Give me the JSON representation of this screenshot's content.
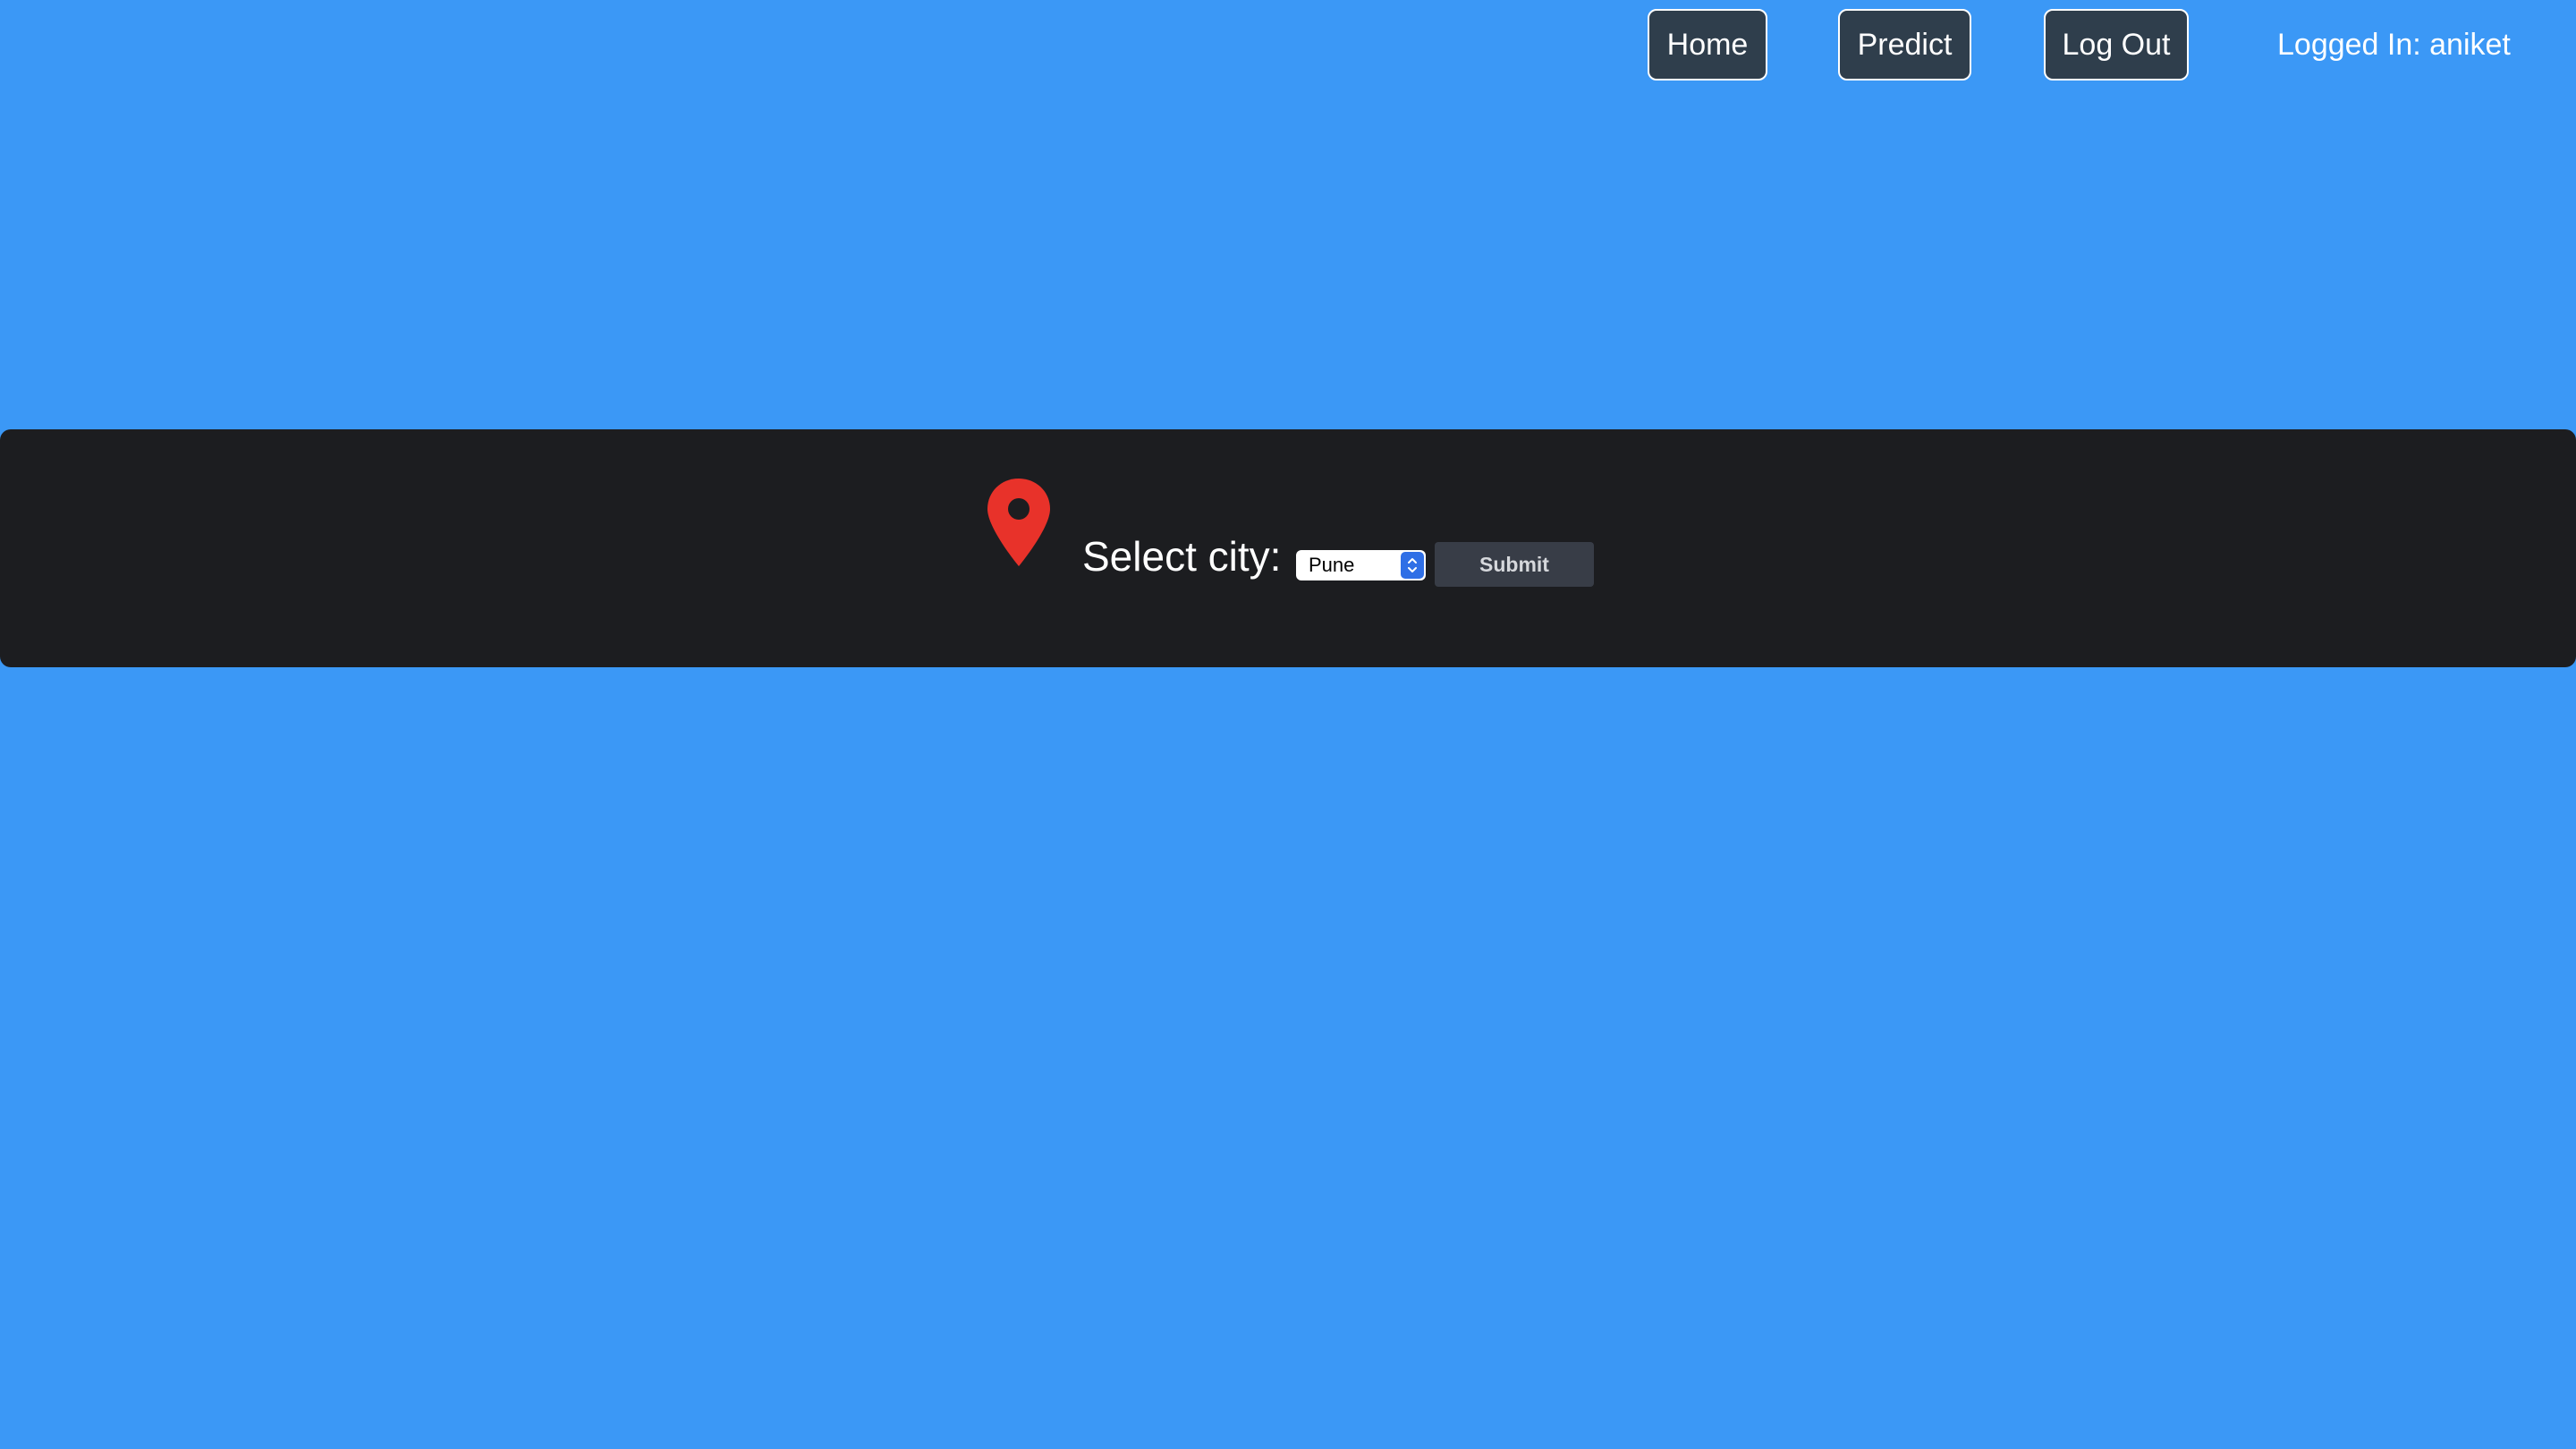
{
  "nav": {
    "home_label": "Home",
    "predict_label": "Predict",
    "logout_label": "Log Out",
    "logged_in_text": "Logged In: aniket"
  },
  "city_form": {
    "label": "Select city:",
    "selected_city": "Pune",
    "submit_label": "Submit",
    "icon": "map-pin-icon"
  },
  "colors": {
    "page_background": "#3b98f6",
    "band_background": "#1c1d20",
    "nav_button": "#2f3e4c",
    "pin": "#e8322a",
    "select_stepper": "#2f6fe6",
    "submit_button": "#383d47"
  }
}
